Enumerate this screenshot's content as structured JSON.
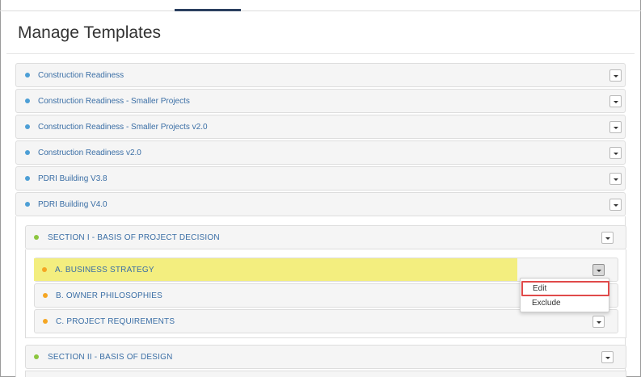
{
  "page": {
    "title": "Manage Templates"
  },
  "templates": [
    {
      "label": "Construction Readiness",
      "dot_color": "#4d9fd6"
    },
    {
      "label": "Construction Readiness - Smaller Projects",
      "dot_color": "#4d9fd6"
    },
    {
      "label": "Construction Readiness - Smaller Projects v2.0",
      "dot_color": "#4d9fd6"
    },
    {
      "label": "Construction Readiness v2.0",
      "dot_color": "#4d9fd6"
    },
    {
      "label": "PDRI Building V3.8",
      "dot_color": "#4d9fd6"
    },
    {
      "label": "PDRI Building V4.0",
      "dot_color": "#4d9fd6"
    }
  ],
  "sections": [
    {
      "label": "SECTION I - BASIS OF PROJECT DECISION",
      "dot_color": "#8cc63f"
    },
    {
      "label": "SECTION II - BASIS OF DESIGN",
      "dot_color": "#8cc63f"
    }
  ],
  "subsections": [
    {
      "label": "A. BUSINESS STRATEGY",
      "dot_color": "#f5a623",
      "highlighted": true
    },
    {
      "label": "B. OWNER PHILOSOPHIES",
      "dot_color": "#f5a623"
    },
    {
      "label": "C. PROJECT REQUIREMENTS",
      "dot_color": "#f5a623"
    }
  ],
  "context_menu": {
    "items": [
      "Edit",
      "Exclude"
    ]
  },
  "colors": {
    "highlight": "#f3ee7f",
    "edit_outline": "#e04a4a",
    "link_text": "#3a6ea5"
  },
  "icons": {
    "toggle": "chevron-down-icon"
  }
}
